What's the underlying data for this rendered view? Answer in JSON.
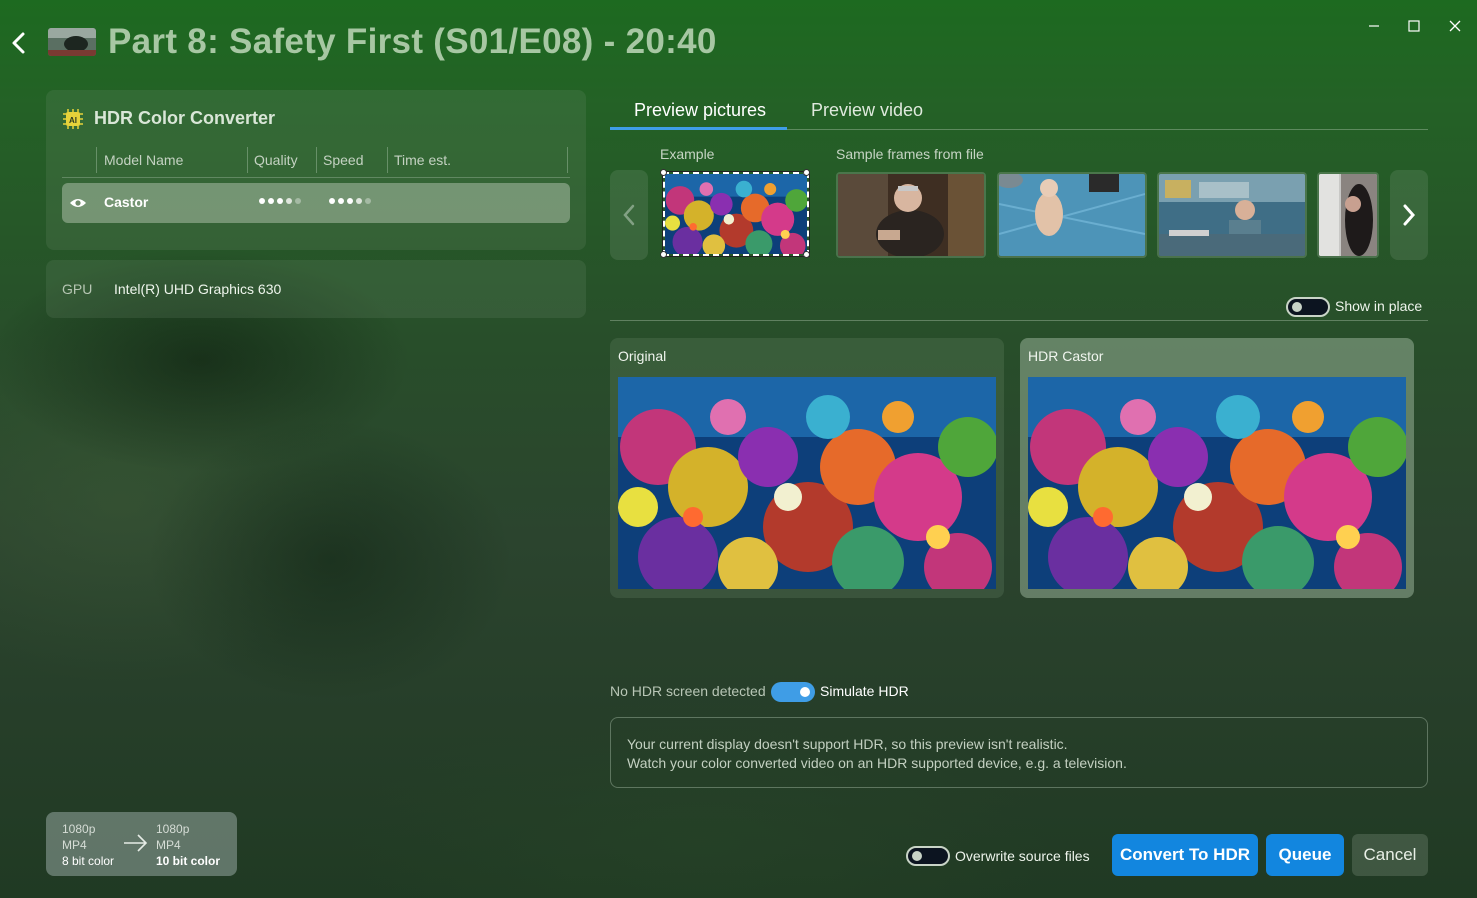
{
  "header": {
    "title": "Part 8: Safety First (S01/E08) - 20:40"
  },
  "converter": {
    "title": "HDR Color Converter",
    "ai_badge": "AI",
    "columns": [
      "Model Name",
      "Quality",
      "Speed",
      "Time est."
    ],
    "model": {
      "name": "Castor",
      "quality": 3.5,
      "speed": 3.5,
      "time_est": ""
    }
  },
  "gpu": {
    "label": "GPU",
    "value": "Intel(R) UHD Graphics 630"
  },
  "tabs": [
    {
      "label": "Preview pictures",
      "active": true
    },
    {
      "label": "Preview video",
      "active": false
    }
  ],
  "frames": {
    "example_label": "Example",
    "sample_label": "Sample frames from file"
  },
  "show_in_place": {
    "label": "Show in place",
    "on": false
  },
  "preview": {
    "original_label": "Original",
    "hdr_label": "HDR Castor"
  },
  "hdr_status": {
    "no_hdr_text": "No HDR screen detected",
    "simulate_label": "Simulate HDR",
    "simulate_on": true
  },
  "info": {
    "line1": "Your current display doesn't support HDR, so this preview isn't realistic.",
    "line2": "Watch your color converted video on an HDR supported device, e.g. a television."
  },
  "format": {
    "source": {
      "resolution": "1080p",
      "container": "MP4",
      "color": "8 bit color"
    },
    "target": {
      "resolution": "1080p",
      "container": "MP4",
      "color": "10 bit color"
    }
  },
  "footer": {
    "overwrite_label": "Overwrite source files",
    "overwrite_on": false,
    "convert_label": "Convert To HDR",
    "queue_label": "Queue",
    "cancel_label": "Cancel"
  },
  "colors": {
    "accent": "#1286df",
    "tab_accent": "#3f9de6",
    "title": "#a7c7a3"
  }
}
